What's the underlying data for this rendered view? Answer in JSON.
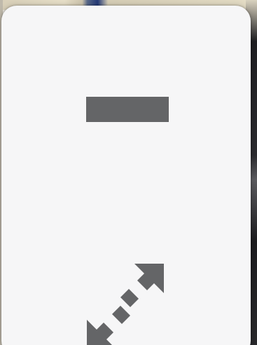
{
  "panel": {
    "background": "#f6f6f7",
    "controls": [
      {
        "id": "minimize",
        "icon": "minimize-icon"
      },
      {
        "id": "expand",
        "icon": "expand-diagonal-arrows-icon"
      }
    ]
  },
  "colors": {
    "icon": "#646567"
  }
}
